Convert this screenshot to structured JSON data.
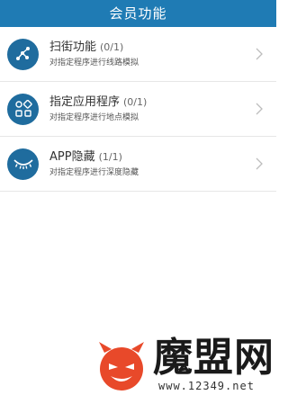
{
  "header": {
    "title": "会员功能"
  },
  "colors": {
    "accent": "#1f7bb4",
    "icon_bg": "#1f6c9e"
  },
  "items": [
    {
      "title": "扫街功能",
      "count": "(0/1)",
      "subtitle": "对指定程序进行线路模拟",
      "icon": "route-icon"
    },
    {
      "title": "指定应用程序",
      "count": "(0/1)",
      "subtitle": "对指定程序进行地点模拟",
      "icon": "apps-grid-icon"
    },
    {
      "title": "APP隐藏",
      "count": "(1/1)",
      "subtitle": "对指定程序进行深度隐藏",
      "icon": "closed-eye-icon"
    }
  ],
  "watermark": {
    "brand": "魔盟网",
    "url": "www.12349.net"
  }
}
